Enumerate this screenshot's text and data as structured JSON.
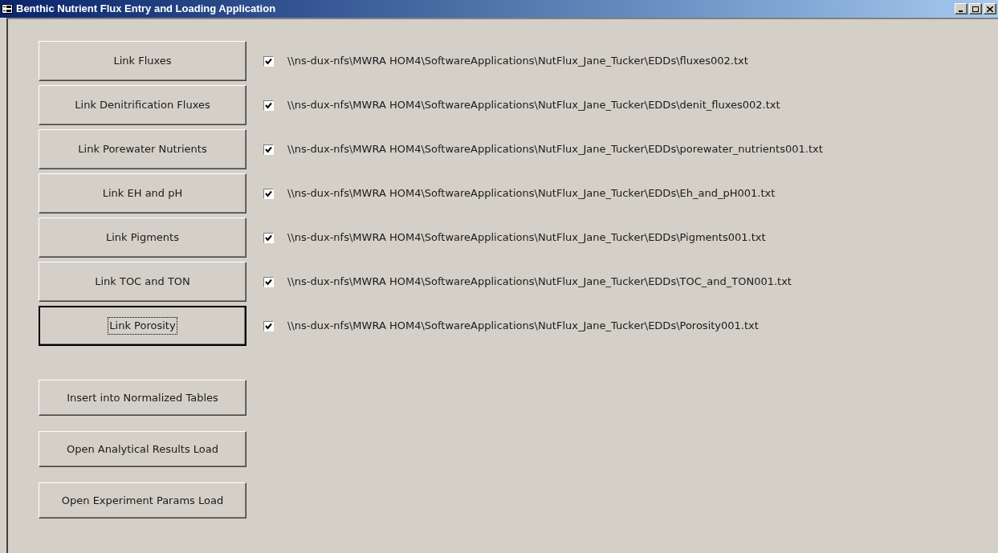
{
  "window": {
    "title": "Benthic Nutrient Flux Entry and Loading Application"
  },
  "link_rows": [
    {
      "button": "Link Fluxes",
      "focused": false,
      "checked": true,
      "path": "\\\\ns-dux-nfs\\MWRA HOM4\\SoftwareApplications\\NutFlux_Jane_Tucker\\EDDs\\fluxes002.txt"
    },
    {
      "button": "Link Denitrification Fluxes",
      "focused": false,
      "checked": true,
      "path": "\\\\ns-dux-nfs\\MWRA HOM4\\SoftwareApplications\\NutFlux_Jane_Tucker\\EDDs\\denit_fluxes002.txt"
    },
    {
      "button": "Link Porewater Nutrients",
      "focused": false,
      "checked": true,
      "path": "\\\\ns-dux-nfs\\MWRA HOM4\\SoftwareApplications\\NutFlux_Jane_Tucker\\EDDs\\porewater_nutrients001.txt"
    },
    {
      "button": "Link EH and pH",
      "focused": false,
      "checked": true,
      "path": "\\\\ns-dux-nfs\\MWRA HOM4\\SoftwareApplications\\NutFlux_Jane_Tucker\\EDDs\\Eh_and_pH001.txt"
    },
    {
      "button": "Link Pigments",
      "focused": false,
      "checked": true,
      "path": "\\\\ns-dux-nfs\\MWRA HOM4\\SoftwareApplications\\NutFlux_Jane_Tucker\\EDDs\\Pigments001.txt"
    },
    {
      "button": "Link TOC and TON",
      "focused": false,
      "checked": true,
      "path": "\\\\ns-dux-nfs\\MWRA HOM4\\SoftwareApplications\\NutFlux_Jane_Tucker\\EDDs\\TOC_and_TON001.txt"
    },
    {
      "button": "Link Porosity",
      "focused": true,
      "checked": true,
      "path": "\\\\ns-dux-nfs\\MWRA HOM4\\SoftwareApplications\\NutFlux_Jane_Tucker\\EDDs\\Porosity001.txt"
    }
  ],
  "action_buttons": [
    "Insert into Normalized Tables",
    "Open Analytical Results Load",
    "Open Experiment Params Load"
  ]
}
